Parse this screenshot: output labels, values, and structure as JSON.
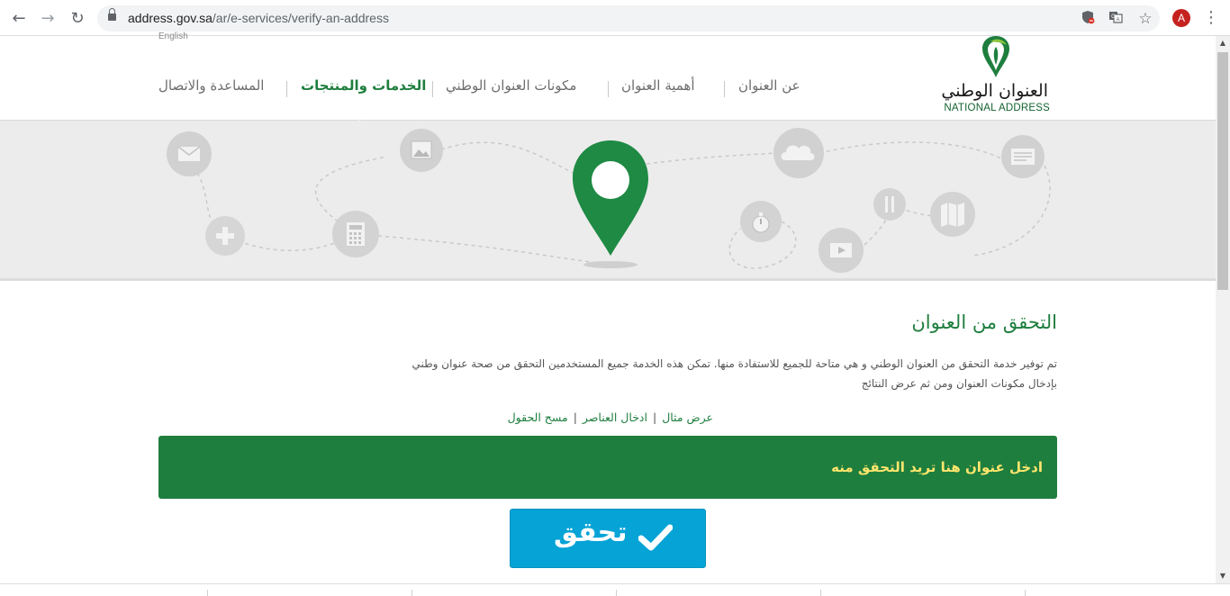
{
  "browser": {
    "url_host": "address.gov.sa",
    "url_path": "/ar/e-services/verify-an-address",
    "profile_initial": "A",
    "icons": [
      "back-icon",
      "forward-icon",
      "reload-icon",
      "lock-icon",
      "shield-blocked-icon",
      "translate-icon",
      "star-icon",
      "avatar",
      "menu-kebab-icon"
    ]
  },
  "header": {
    "english_link": "English",
    "nav": [
      {
        "label": "عن العنوان",
        "active": false
      },
      {
        "label": "أهمية العنوان",
        "active": false
      },
      {
        "label": "مكونات العنوان الوطني",
        "active": false
      },
      {
        "label": "الخدمات والمنتجات",
        "active": true
      },
      {
        "label": "المساعدة والاتصال",
        "active": false
      }
    ],
    "logo_ar": "العنوان الوطني",
    "logo_en": "NATIONAL ADDRESS"
  },
  "banner": {
    "icons": [
      "mail-icon",
      "gamepad-icon",
      "image-icon",
      "calculator-icon",
      "map-pin-icon",
      "cloud-icon",
      "stopwatch-icon",
      "video-icon",
      "tools-icon",
      "map-icon",
      "document-icon"
    ]
  },
  "content": {
    "title": "التحقق من العنوان",
    "description": "تم توفير خدمة التحقق من العنوان الوطني و هي متاحة للجميع للاستفادة منها. تمكن هذه الخدمة جميع المستخدمين التحقق من صحة عنوان وطني بإدخال مكونات العنوان ومن ثم عرض النتائج",
    "links": [
      "عرض مثال",
      "ادخال العناصر",
      "مسح الحقول"
    ],
    "address_prompt": "ادخل عنوان هنا تريد التحقق منه",
    "verify_label": "تحقق"
  },
  "colors": {
    "brand_green": "#1e7e3e",
    "prompt_yellow": "#ffe66d",
    "button_blue": "#05a3d6"
  }
}
